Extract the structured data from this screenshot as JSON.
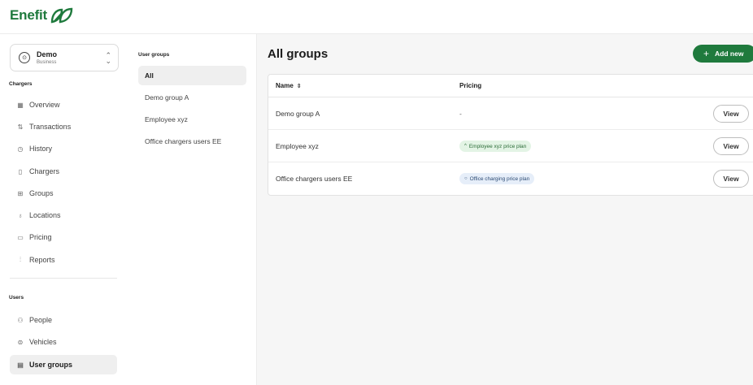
{
  "brand": {
    "name": "Enefit",
    "accent": "#1f7a3d"
  },
  "account": {
    "name": "Demo",
    "type": "Business"
  },
  "sidebar": {
    "chargers_title": "Chargers",
    "chargers_items": [
      {
        "label": "Overview",
        "icon": "grid-icon"
      },
      {
        "label": "Transactions",
        "icon": "arrows-icon"
      },
      {
        "label": "History",
        "icon": "clock-icon"
      },
      {
        "label": "Chargers",
        "icon": "charger-icon"
      },
      {
        "label": "Groups",
        "icon": "groups-icon"
      },
      {
        "label": "Locations",
        "icon": "pin-icon"
      },
      {
        "label": "Pricing",
        "icon": "tag-icon"
      },
      {
        "label": "Reports",
        "icon": "chart-icon"
      }
    ],
    "users_title": "Users",
    "users_items": [
      {
        "label": "People",
        "icon": "people-icon"
      },
      {
        "label": "Vehicles",
        "icon": "car-icon"
      },
      {
        "label": "User groups",
        "icon": "user-groups-icon",
        "active": true
      }
    ]
  },
  "groups_panel": {
    "title": "User groups",
    "items": [
      "All",
      "Demo group A",
      "Employee xyz",
      "Office chargers users EE"
    ]
  },
  "main": {
    "title": "All groups",
    "add_button": "Add new",
    "columns": [
      "Name",
      "Pricing"
    ],
    "rows": [
      {
        "name": "Demo group A",
        "pricing": "-",
        "pricing_style": "none",
        "action": "View"
      },
      {
        "name": "Employee xyz",
        "pricing": "Employee xyz price plan",
        "pricing_style": "green",
        "action": "View"
      },
      {
        "name": "Office chargers users EE",
        "pricing": "Office charging price plan",
        "pricing_style": "blue",
        "action": "View"
      }
    ]
  }
}
